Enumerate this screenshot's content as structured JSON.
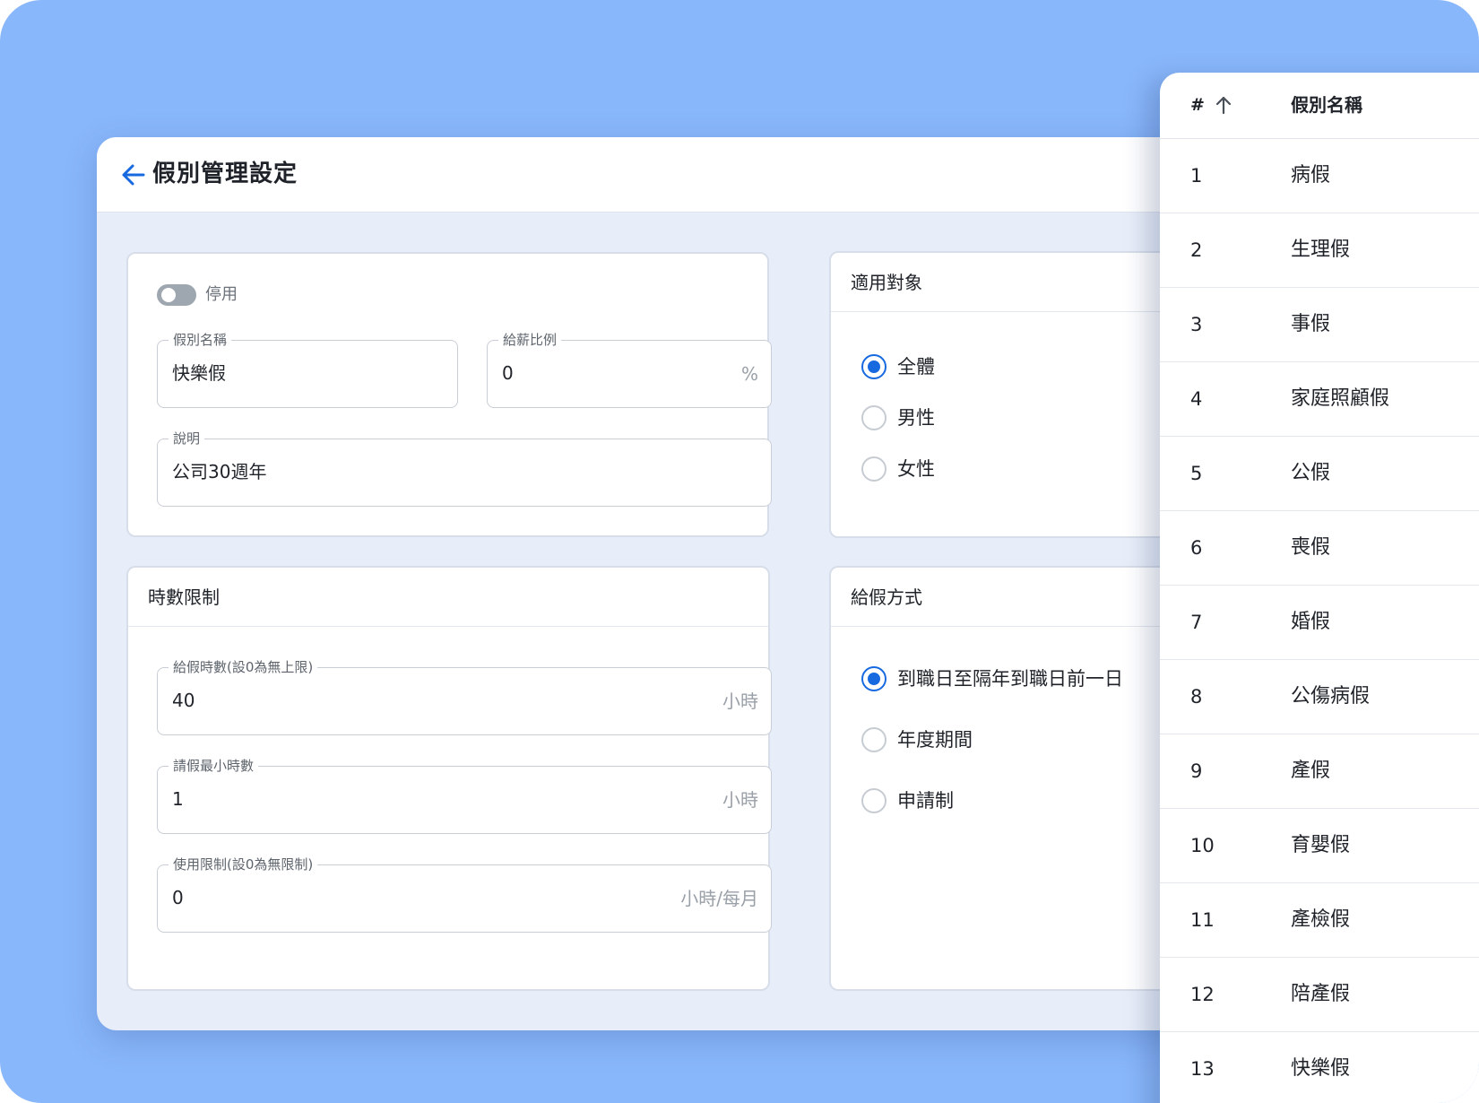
{
  "header": {
    "title": "假別管理設定"
  },
  "basic": {
    "toggle_label": "停用",
    "name_field": {
      "label": "假別名稱",
      "value": "快樂假"
    },
    "pay_field": {
      "label": "給薪比例",
      "value": "0",
      "suffix": "%"
    },
    "desc_field": {
      "label": "說明",
      "value": "公司30週年"
    }
  },
  "target": {
    "title": "適用對象",
    "options": [
      "全體",
      "男性",
      "女性"
    ],
    "selected": "全體"
  },
  "hours": {
    "title": "時數限制",
    "grant_field": {
      "label": "給假時數(設0為無上限)",
      "value": "40",
      "suffix": "小時"
    },
    "min_field": {
      "label": "請假最小時數",
      "value": "1",
      "suffix": "小時"
    },
    "limit_field": {
      "label": "使用限制(設0為無限制)",
      "value": "0",
      "suffix": "小時/每月"
    }
  },
  "method": {
    "title": "給假方式",
    "options": [
      "到職日至隔年到職日前一日",
      "年度期間",
      "申請制"
    ],
    "selected": "到職日至隔年到職日前一日"
  },
  "list": {
    "col_num": "#",
    "col_name": "假別名稱",
    "rows": [
      {
        "num": "1",
        "name": "病假"
      },
      {
        "num": "2",
        "name": "生理假"
      },
      {
        "num": "3",
        "name": "事假"
      },
      {
        "num": "4",
        "name": "家庭照顧假"
      },
      {
        "num": "5",
        "name": "公假"
      },
      {
        "num": "6",
        "name": "喪假"
      },
      {
        "num": "7",
        "name": "婚假"
      },
      {
        "num": "8",
        "name": "公傷病假"
      },
      {
        "num": "9",
        "name": "產假"
      },
      {
        "num": "10",
        "name": "育嬰假"
      },
      {
        "num": "11",
        "name": "產檢假"
      },
      {
        "num": "12",
        "name": "陪產假"
      },
      {
        "num": "13",
        "name": "快樂假"
      }
    ]
  },
  "colors": {
    "accent": "#1769e0",
    "background": "#89b7fb"
  }
}
